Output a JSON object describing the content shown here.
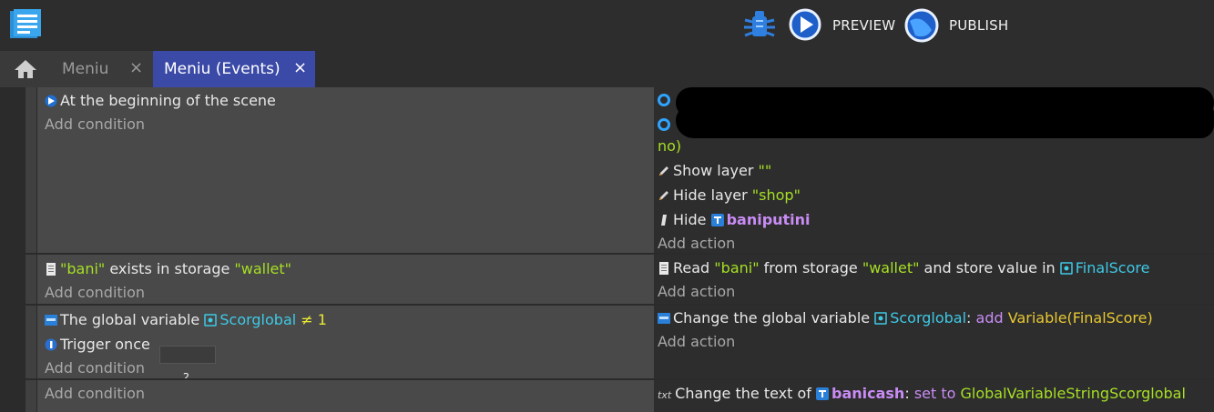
{
  "toolbar": {
    "preview_label": "PREVIEW",
    "publish_label": "PUBLISH"
  },
  "tabs": [
    {
      "label": "Meniu",
      "close": "×",
      "active": false
    },
    {
      "label": "Meniu (Events)",
      "close": "×",
      "active": true
    }
  ],
  "events": [
    {
      "conditions": [
        {
          "text": "At the beginning of the scene"
        }
      ],
      "add_condition": "Add condition",
      "actions": [
        {
          "partial": "no)"
        },
        {
          "prefix": "Show layer ",
          "value": "\"\""
        },
        {
          "prefix": "Hide layer ",
          "value": "\"shop\""
        },
        {
          "prefix": "Hide ",
          "object": "baniputini"
        }
      ],
      "add_action": "Add action"
    },
    {
      "conditions": [
        {
          "key": "\"bani\"",
          "middle": " exists in storage ",
          "storage": "\"wallet\""
        }
      ],
      "add_condition": "Add condition",
      "actions": [
        {
          "prefix": "Read ",
          "key": "\"bani\"",
          "middle": " from storage ",
          "storage": "\"wallet\"",
          "tail": " and store value in ",
          "variable": "FinalScore"
        }
      ],
      "add_action": "Add action"
    },
    {
      "conditions": [
        {
          "prefix": "The global variable ",
          "variable": "Scorglobal",
          "operator": "≠",
          "value": "1"
        },
        {
          "text": "Trigger once"
        }
      ],
      "add_condition": "Add condition",
      "badge": "2",
      "actions": [
        {
          "prefix": "Change the global variable ",
          "variable": "Scorglobal",
          "colon": ": ",
          "op": "add",
          "expr": "Variable(FinalScore)"
        }
      ],
      "add_action": "Add action"
    },
    {
      "add_condition": "Add condition",
      "actions": [
        {
          "prefix": "Change the text of ",
          "object": "banicash",
          "colon": ": ",
          "op": "set to",
          "expr": "GlobalVariableStringScorglobal"
        }
      ]
    }
  ],
  "colors": {
    "string": "#a6df24",
    "variable": "#3ec9e6",
    "object": "#c98cf5",
    "active_tab": "#3b4aa6"
  }
}
